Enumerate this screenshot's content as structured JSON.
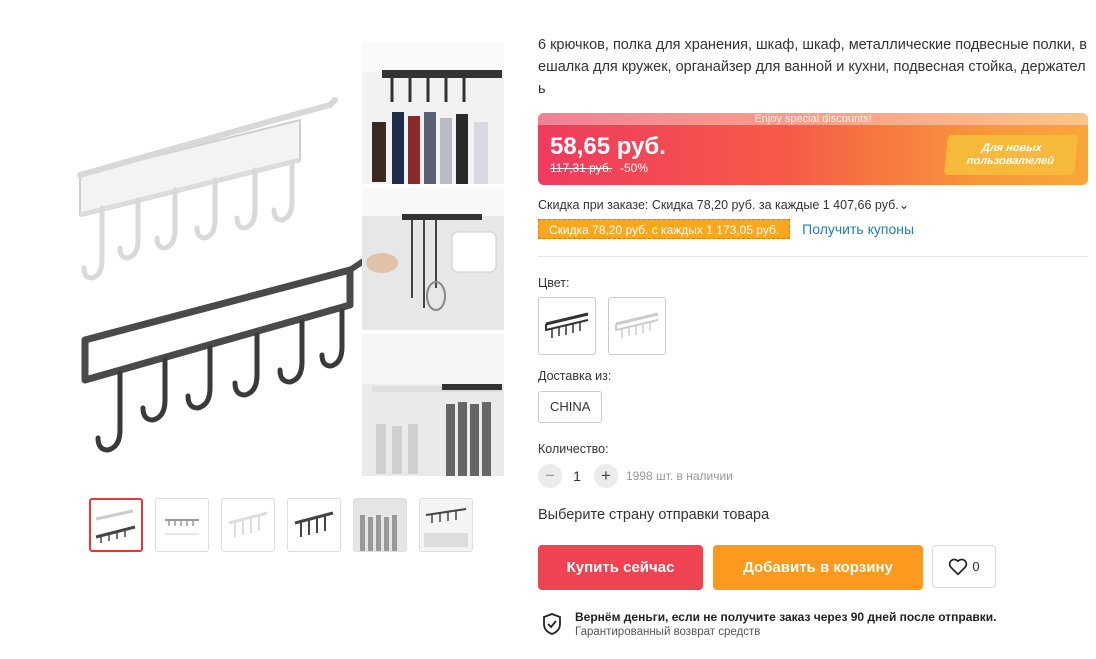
{
  "product": {
    "title": "6 крючков, полка для хранения, шкаф, шкаф, металлические подвесные полки, вешалка для кружек, органайзер для ванной и кухни, подвесная стойка, держатель"
  },
  "price": {
    "banner_text": "Enjoy special discounts!",
    "current": "58,65 руб.",
    "original": "117,31 руб.",
    "discount": "-50%",
    "new_user_badge": "Для новых пользователей"
  },
  "discounts": {
    "order_discount": "Скидка при заказе: Скидка 78,20 руб. за каждые 1 407,66 руб.",
    "coupon_tag": "Скидка 78,20 руб. с каждых 1 173,05 руб.",
    "get_coupons": "Получить купоны"
  },
  "options": {
    "color_label": "Цвет:",
    "color_swatches": [
      "black-hanger-rack",
      "white-hanger-rack"
    ],
    "ship_from_label": "Доставка из:",
    "ship_from_value": "CHINA",
    "quantity_label": "Количество:",
    "quantity_value": "1",
    "minus": "−",
    "plus": "+",
    "stock": "1998 шт. в наличии"
  },
  "choose_country": "Выберите страну отправки товара",
  "actions": {
    "buy_now": "Купить сейчас",
    "add_to_cart": "Добавить в корзину",
    "wishlist_count": "0"
  },
  "guarantee": {
    "title": "Вернём деньги, если не получите заказ через 90 дней после отправки.",
    "subtitle": "Гарантированный возврат средств"
  },
  "colors": {
    "accent_red": "#f04352",
    "accent_orange": "#fb9a1e",
    "link_blue": "#2a7ab8",
    "coupon_yellow": "#f7a81f"
  }
}
